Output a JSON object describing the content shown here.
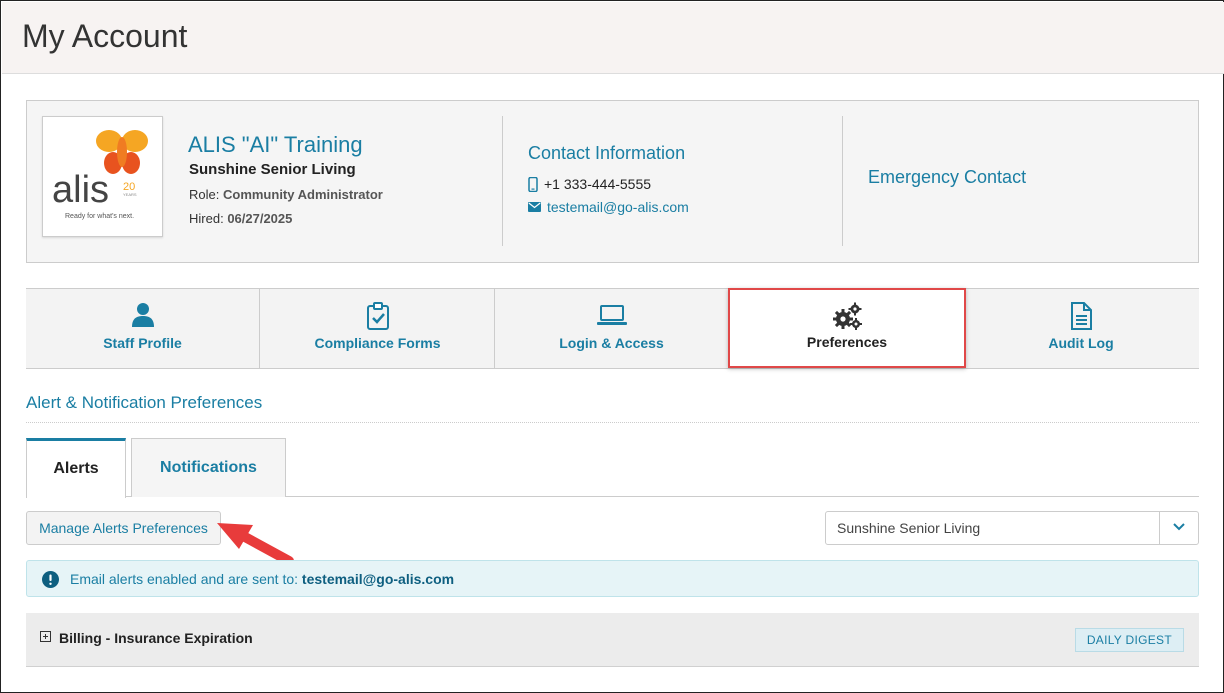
{
  "page": {
    "title": "My Account"
  },
  "profile": {
    "logo": {
      "brand": "alis",
      "badge_number": "20",
      "badge_word": "YEARS",
      "tagline": "Ready for what's next."
    },
    "name": "ALIS \"AI\" Training",
    "facility": "Sunshine Senior Living",
    "role_label": "Role:",
    "role_value": "Community Administrator",
    "hired_label": "Hired:",
    "hired_value": "06/27/2025"
  },
  "contact": {
    "title": "Contact Information",
    "phone": "+1 333-444-5555",
    "email": "testemail@go-alis.com",
    "phone_icon": "mobile-phone-icon",
    "email_icon": "envelope-icon"
  },
  "emergency": {
    "title": "Emergency Contact"
  },
  "tabs": [
    {
      "label": "Staff Profile",
      "icon": "user-icon"
    },
    {
      "label": "Compliance Forms",
      "icon": "clipboard-check-icon"
    },
    {
      "label": "Login & Access",
      "icon": "laptop-icon"
    },
    {
      "label": "Preferences",
      "icon": "gears-icon",
      "active": true
    },
    {
      "label": "Audit Log",
      "icon": "document-icon"
    }
  ],
  "section": {
    "title": "Alert & Notification Preferences"
  },
  "subtabs": {
    "alerts": "Alerts",
    "notifications": "Notifications"
  },
  "manage_button": "Manage Alerts Preferences",
  "community_select": {
    "value": "Sunshine Senior Living"
  },
  "alert": {
    "text": "Email alerts enabled and are sent to:",
    "email": "testemail@go-alis.com"
  },
  "billing_row": {
    "label": "Billing - Insurance Expiration",
    "badge": "DAILY DIGEST"
  },
  "colors": {
    "accent": "#1a7ea3",
    "highlight": "#e04848",
    "arrow": "#e83b3b",
    "logo_orange": "#f5a623",
    "logo_red": "#e8531f"
  }
}
